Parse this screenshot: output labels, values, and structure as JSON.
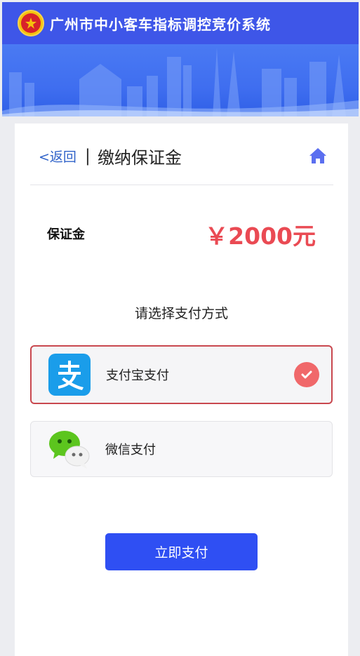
{
  "header": {
    "app_title": "广州市中小客车指标调控竞价系统"
  },
  "nav": {
    "back_label": "<返回",
    "separator": "|",
    "page_title": "缴纳保证金"
  },
  "deposit": {
    "label": "保证金",
    "amount": "￥2000元"
  },
  "payment": {
    "prompt": "请选择支付方式",
    "options": [
      {
        "label": "支付宝支付",
        "icon": "alipay-icon",
        "selected": true
      },
      {
        "label": "微信支付",
        "icon": "wechat-icon",
        "selected": false
      }
    ]
  },
  "actions": {
    "pay_label": "立即支付"
  },
  "colors": {
    "brand_blue": "#3e56e8",
    "accent_red": "#ea4a53",
    "button_blue": "#2f4ff3"
  }
}
